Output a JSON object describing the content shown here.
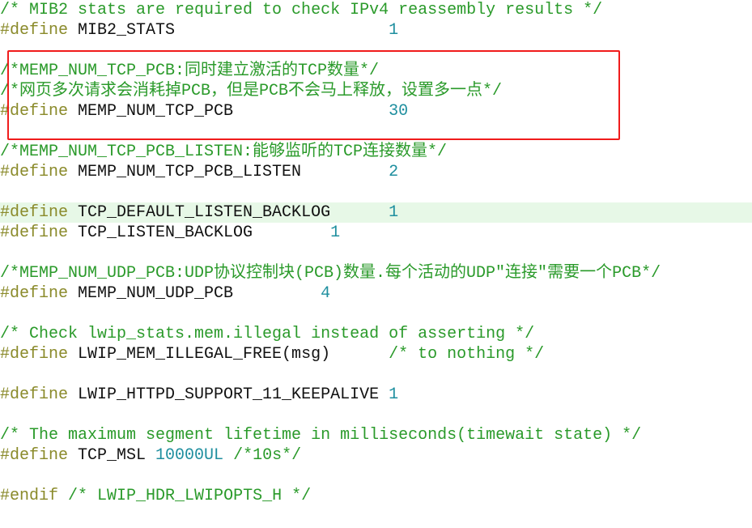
{
  "colors": {
    "comment": "#2a9a2a",
    "keyword": "#8a8a2a",
    "identifier": "#111111",
    "number": "#1f8f9f",
    "highlight_line": "#e7f8e7",
    "annotation_box": "#f01c1c"
  },
  "highlighted_line": 10,
  "lines": [
    {
      "segs": [
        {
          "t": "/* MIB2 stats are required to check IPv4 reassembly results */",
          "c": "cm"
        }
      ]
    },
    {
      "segs": [
        {
          "t": "#define",
          "c": "kw"
        },
        {
          "t": " MIB2_STATS                      ",
          "c": "id"
        },
        {
          "t": "1",
          "c": "num"
        }
      ]
    },
    {
      "segs": []
    },
    {
      "segs": [
        {
          "t": "/*MEMP_NUM_TCP_PCB:同时建立激活的TCP数量*/",
          "c": "cm"
        }
      ]
    },
    {
      "segs": [
        {
          "t": "/*网页多次请求会消耗掉PCB，但是PCB不会马上释放，设置多一点*/",
          "c": "cm"
        }
      ]
    },
    {
      "segs": [
        {
          "t": "#define",
          "c": "kw"
        },
        {
          "t": " MEMP_NUM_TCP_PCB                ",
          "c": "id"
        },
        {
          "t": "30",
          "c": "num"
        }
      ]
    },
    {
      "segs": []
    },
    {
      "segs": [
        {
          "t": "/*MEMP_NUM_TCP_PCB_LISTEN:能够监听的TCP连接数量*/",
          "c": "cm"
        }
      ]
    },
    {
      "segs": [
        {
          "t": "#define",
          "c": "kw"
        },
        {
          "t": " MEMP_NUM_TCP_PCB_LISTEN         ",
          "c": "id"
        },
        {
          "t": "2",
          "c": "num"
        }
      ]
    },
    {
      "segs": []
    },
    {
      "segs": [
        {
          "t": "#define",
          "c": "kw"
        },
        {
          "t": " TCP_DEFAULT_LISTEN_BACKLOG      ",
          "c": "id"
        },
        {
          "t": "1",
          "c": "num"
        }
      ]
    },
    {
      "segs": [
        {
          "t": "#define",
          "c": "kw"
        },
        {
          "t": " TCP_LISTEN_BACKLOG        ",
          "c": "id"
        },
        {
          "t": "1",
          "c": "num"
        }
      ]
    },
    {
      "segs": []
    },
    {
      "segs": [
        {
          "t": "/*MEMP_NUM_UDP_PCB:UDP协议控制块(PCB)数量.每个活动的UDP\"连接\"需要一个PCB*/",
          "c": "cm"
        }
      ]
    },
    {
      "segs": [
        {
          "t": "#define",
          "c": "kw"
        },
        {
          "t": " MEMP_NUM_UDP_PCB         ",
          "c": "id"
        },
        {
          "t": "4",
          "c": "num"
        }
      ]
    },
    {
      "segs": []
    },
    {
      "segs": [
        {
          "t": "/* Check lwip_stats.mem.illegal instead of asserting */",
          "c": "cm"
        }
      ]
    },
    {
      "segs": [
        {
          "t": "#define",
          "c": "kw"
        },
        {
          "t": " LWIP_MEM_ILLEGAL_FREE(msg)      ",
          "c": "id"
        },
        {
          "t": "/* to nothing */",
          "c": "cm"
        }
      ]
    },
    {
      "segs": []
    },
    {
      "segs": [
        {
          "t": "#define",
          "c": "kw"
        },
        {
          "t": " LWIP_HTTPD_SUPPORT_11_KEEPALIVE ",
          "c": "id"
        },
        {
          "t": "1",
          "c": "num"
        }
      ]
    },
    {
      "segs": []
    },
    {
      "segs": [
        {
          "t": "/* The maximum segment lifetime in milliseconds(timewait state) */",
          "c": "cm"
        }
      ]
    },
    {
      "segs": [
        {
          "t": "#define",
          "c": "kw"
        },
        {
          "t": " TCP_MSL ",
          "c": "id"
        },
        {
          "t": "10000UL",
          "c": "num"
        },
        {
          "t": " ",
          "c": "id"
        },
        {
          "t": "/*10s*/",
          "c": "cm"
        }
      ]
    },
    {
      "segs": []
    },
    {
      "segs": [
        {
          "t": "#endif",
          "c": "kw"
        },
        {
          "t": " ",
          "c": "id"
        },
        {
          "t": "/* LWIP_HDR_LWIPOPTS_H */",
          "c": "cm"
        }
      ]
    }
  ]
}
